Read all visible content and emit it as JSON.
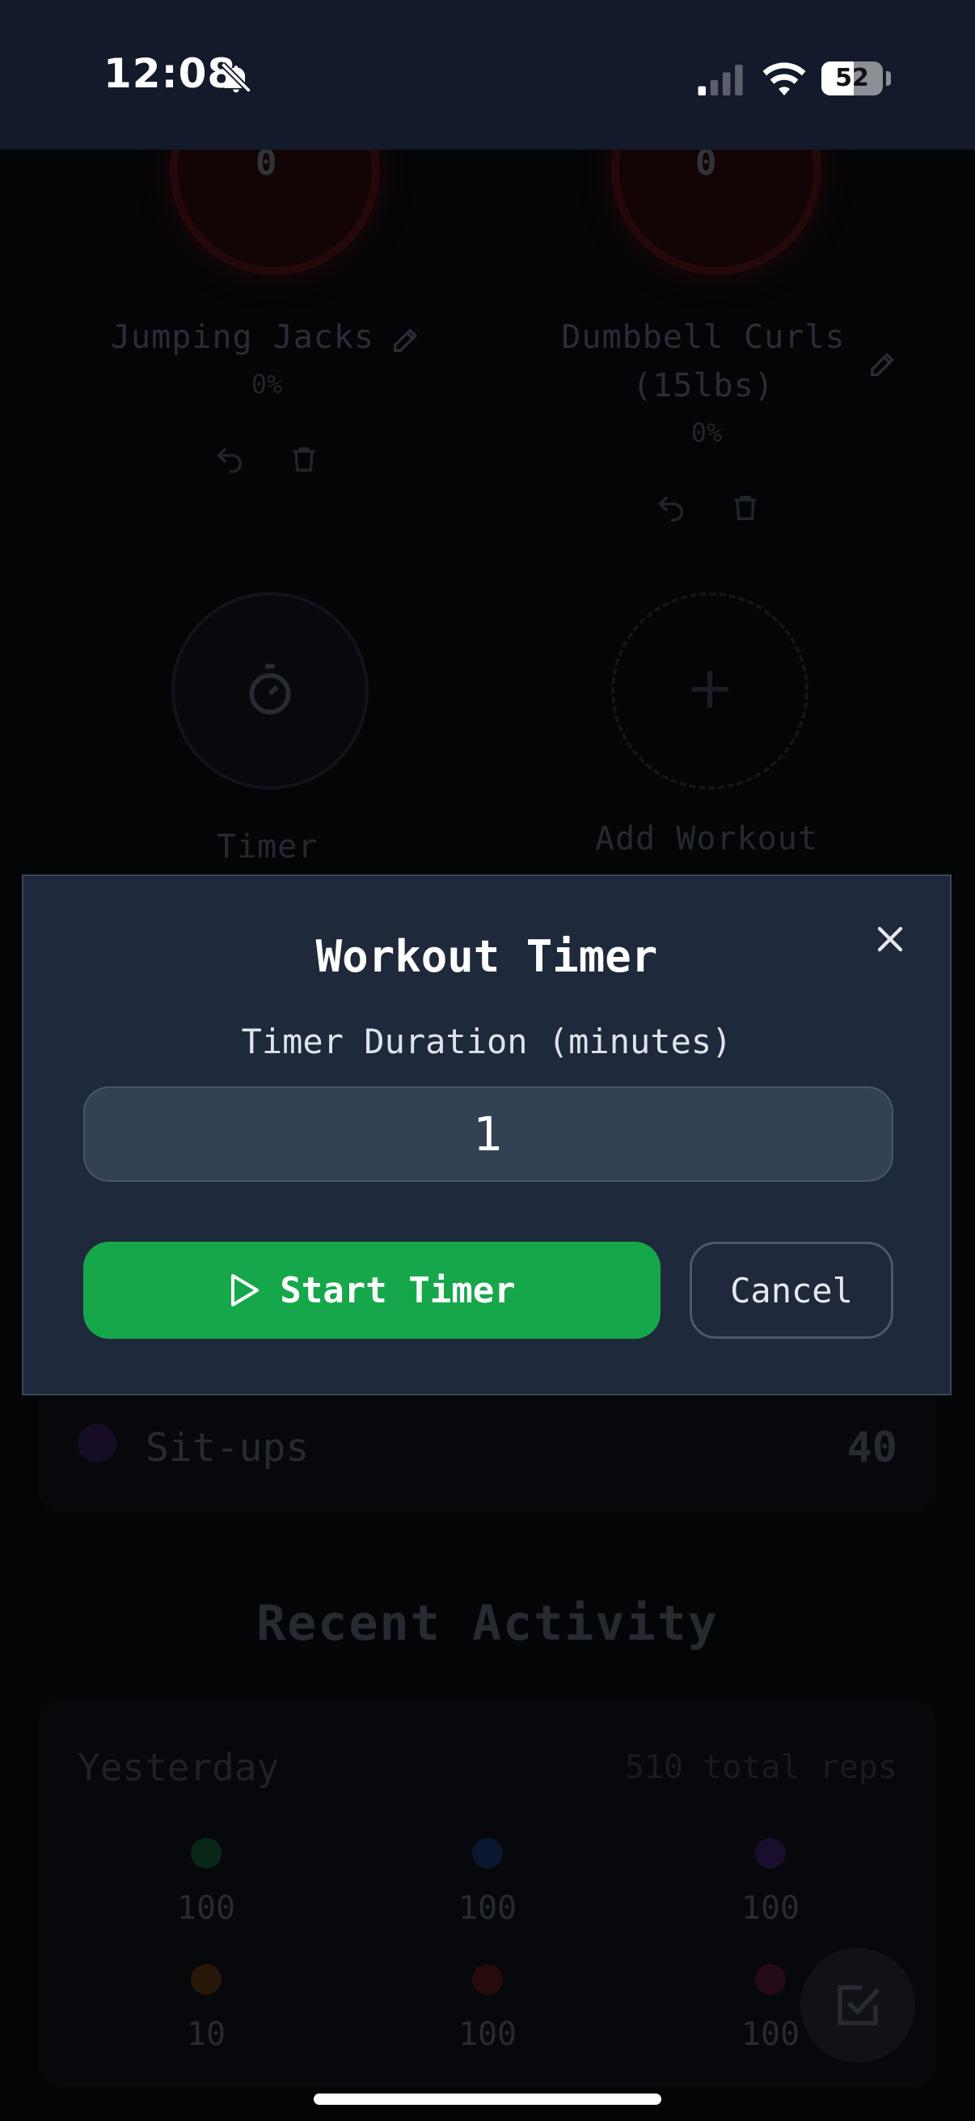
{
  "status_bar": {
    "time": "12:08",
    "battery": "52",
    "battery_level": 0.52
  },
  "workouts": [
    {
      "name": "Jumping Jacks",
      "percent": "0%",
      "count": "0"
    },
    {
      "name_line1": "Dumbbell Curls",
      "name_line2": "(15lbs)",
      "percent": "0%",
      "count": "0"
    }
  ],
  "tiles": {
    "timer": "Timer",
    "add_workout": "Add Workout"
  },
  "summary": {
    "label": "Sit-ups",
    "value": "40"
  },
  "recent": {
    "title": "Recent Activity",
    "day": "Yesterday",
    "total": "510 total reps",
    "items": [
      "100",
      "100",
      "100",
      "10",
      "100",
      "100"
    ],
    "colors": [
      "#0f3d24",
      "#10244a",
      "#2a1545",
      "#3d2510",
      "#3d1210",
      "#3a1024"
    ]
  },
  "modal": {
    "title": "Workout Timer",
    "field_label": "Timer Duration (minutes)",
    "duration_value": "1",
    "start_label": "Start Timer",
    "cancel_label": "Cancel"
  },
  "colors": {
    "accent": "#17a74b",
    "modal_bg": "#1e293b",
    "input_bg": "#334155"
  }
}
